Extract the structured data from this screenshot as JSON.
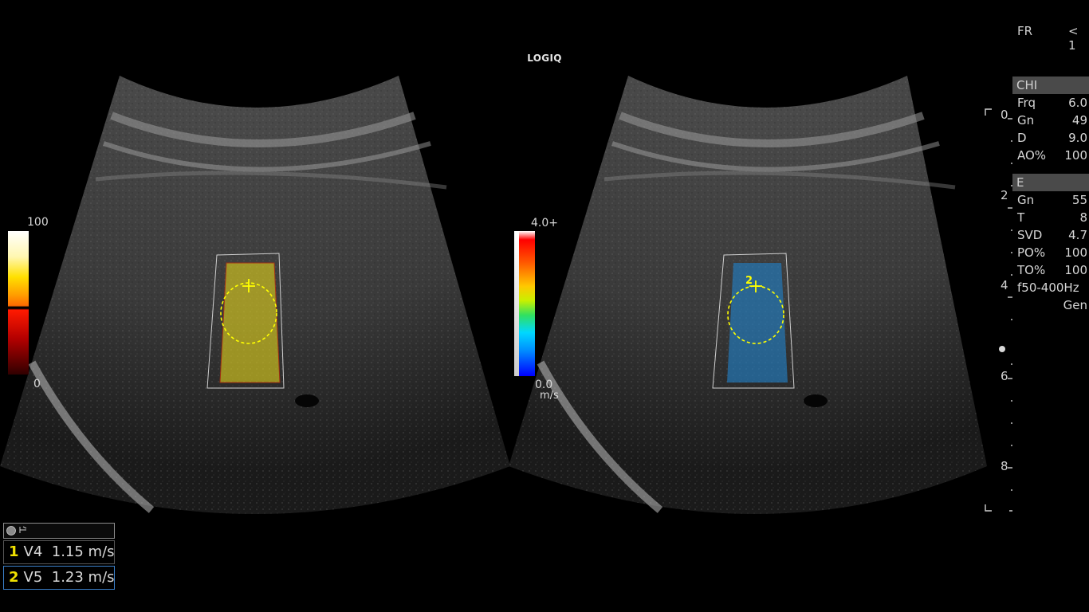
{
  "app": {
    "title": "LOGIQ"
  },
  "left_colorbar": {
    "max_label": "100",
    "min_label": "0"
  },
  "right_colorbar": {
    "max_label": "4.0+",
    "min_label": "0.0",
    "unit": "m/s"
  },
  "frame_rate": {
    "label": "FR",
    "value": "< 1"
  },
  "param_panel": {
    "chi": {
      "header": "CHI",
      "rows": [
        {
          "label": "Frq",
          "value": "6.0"
        },
        {
          "label": "Gn",
          "value": "49"
        },
        {
          "label": "D",
          "value": "9.0"
        },
        {
          "label": "AO%",
          "value": "100"
        }
      ]
    },
    "e": {
      "header": "E",
      "rows": [
        {
          "label": "Gn",
          "value": "55"
        },
        {
          "label": "T",
          "value": "8"
        },
        {
          "label": "SVD",
          "value": "4.7"
        },
        {
          "label": "PO%",
          "value": "100"
        },
        {
          "label": "TO%",
          "value": "100"
        }
      ],
      "filter": "f50-400Hz",
      "mode": "Gen"
    }
  },
  "depth_scale": {
    "labels": [
      "0",
      "2",
      "4",
      "6",
      "8"
    ]
  },
  "right_roi_marker": "2",
  "measurements": [
    {
      "index": "1",
      "label": "V4",
      "value": "1.15 m/s"
    },
    {
      "index": "2",
      "label": "V5",
      "value": "1.23 m/s"
    }
  ],
  "colors": {
    "background": "#000000",
    "left_overlay": "#d6c81e",
    "right_overlay": "#1f6fd0",
    "roi_circle": "#ffff00",
    "panel_header": "#4a4a4a",
    "active_meas_border": "#3a7fc8"
  }
}
